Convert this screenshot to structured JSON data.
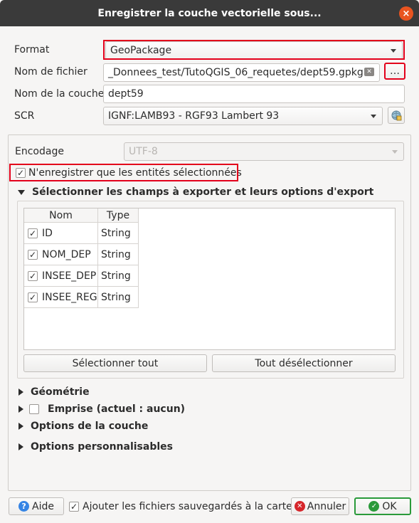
{
  "window": {
    "title": "Enregistrer la couche vectorielle sous...",
    "close_glyph": "×"
  },
  "form": {
    "format_label": "Format",
    "format_value": "GeoPackage",
    "filename_label": "Nom de fichier",
    "filename_value": "_Donnees_test/TutoQGIS_06_requetes/dept59.gpkg",
    "browse_label": "…",
    "layername_label": "Nom de la couche",
    "layername_value": "dept59",
    "crs_label": "SCR",
    "crs_value": "IGNF:LAMB93 - RGF93 Lambert 93"
  },
  "options": {
    "encoding_label": "Encodage",
    "encoding_value": "UTF-8",
    "selected_only_label": "N'enregistrer que les entités sélectionnées",
    "selected_only_checked": "✓",
    "fields_section_label": "Sélectionner les champs à exporter et leurs options d'export",
    "table": {
      "headers": [
        "Nom",
        "Type"
      ],
      "rows": [
        {
          "check": "✓",
          "name": "ID",
          "type": "String"
        },
        {
          "check": "✓",
          "name": "NOM_DEP",
          "type": "String"
        },
        {
          "check": "✓",
          "name": "INSEE_DEP",
          "type": "String"
        },
        {
          "check": "✓",
          "name": "INSEE_REG",
          "type": "String"
        }
      ]
    },
    "select_all_label": "Sélectionner tout",
    "deselect_all_label": "Tout désélectionner",
    "geometry_label": "Géométrie",
    "extent_label": "Emprise (actuel : aucun)",
    "layer_options_label": "Options de la couche",
    "custom_options_label": "Options personnalisables"
  },
  "footer": {
    "help_label": "Aide",
    "add_to_map_label": "Ajouter les fichiers sauvegardés à la carte",
    "add_to_map_checked": "✓",
    "cancel_label": "Annuler",
    "ok_label": "OK"
  },
  "colors": {
    "highlight_red": "#e3001b",
    "titlebar": "#3a3a3a",
    "close": "#e95420",
    "ok_border": "#2a9a3a"
  }
}
